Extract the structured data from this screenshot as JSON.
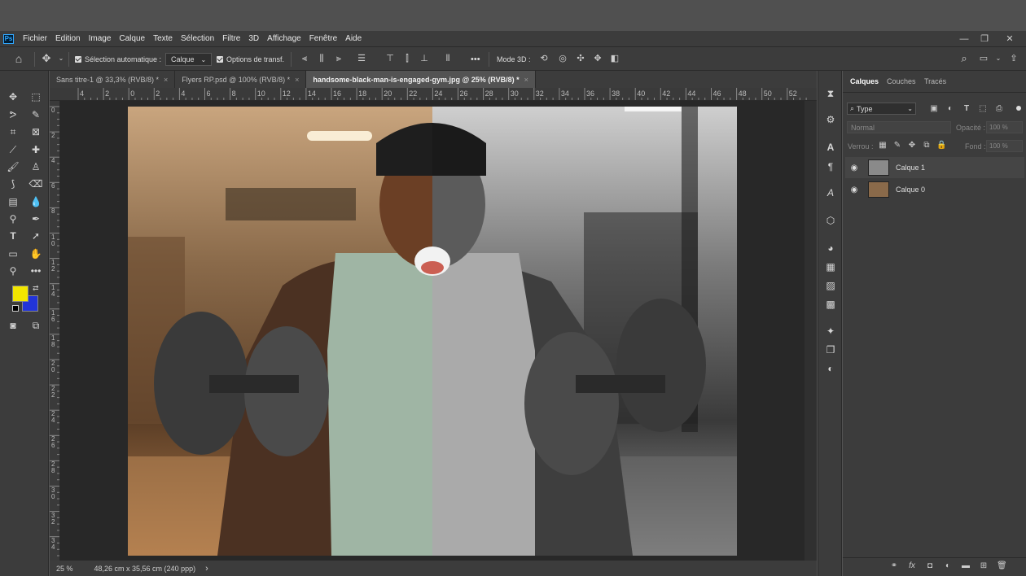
{
  "app": {
    "logo": "Ps"
  },
  "menu": [
    "Fichier",
    "Edition",
    "Image",
    "Calque",
    "Texte",
    "Sélection",
    "Filtre",
    "3D",
    "Affichage",
    "Fenêtre",
    "Aide"
  ],
  "window_controls": {
    "minimize": "—",
    "restore": "❐",
    "close": "✕"
  },
  "options": {
    "auto_select_label": "Sélection automatique :",
    "auto_select_value": "Calque",
    "transform_label": "Options de transf.",
    "more": "•••",
    "mode3d_label": "Mode 3D :"
  },
  "tabs": [
    {
      "label": "Sans titre-1 @ 33,3% (RVB/8) *",
      "close": "×"
    },
    {
      "label": "Flyers RP.psd @ 100% (RVB/8) *",
      "close": "×"
    },
    {
      "label": "handsome-black-man-is-engaged-gym.jpg @ 25% (RVB/8) *",
      "close": "×"
    }
  ],
  "ruler_h": [
    "4",
    "2",
    "0",
    "2",
    "4",
    "6",
    "8",
    "10",
    "12",
    "14",
    "16",
    "18",
    "20",
    "22",
    "24",
    "26",
    "28",
    "30",
    "32",
    "34",
    "36",
    "38",
    "40",
    "42",
    "44",
    "46",
    "48",
    "50",
    "52"
  ],
  "ruler_v": [
    "0",
    "2",
    "4",
    "6",
    "8",
    "1\n0",
    "1\n2",
    "1\n4",
    "1\n6",
    "1\n8",
    "2\n0",
    "2\n2",
    "2\n4",
    "2\n6",
    "2\n8",
    "3\n0",
    "3\n2",
    "3\n4"
  ],
  "status": {
    "zoom": "25 %",
    "doc_size": "48,26 cm x 35,56 cm (240 ppp)",
    "arrow": "›"
  },
  "colors": {
    "foreground": "#f2e600",
    "background": "#2234d8",
    "ps_blue": "#31a8ff"
  },
  "panel": {
    "tabs": [
      "Calques",
      "Couches",
      "Tracés"
    ],
    "filter_label": "Type",
    "blend_mode": "Normal",
    "opacity_label": "Opacité :",
    "opacity_value": "100 %",
    "lock_label": "Verrou :",
    "fill_label": "Fond :",
    "fill_value": "100 %",
    "layers": [
      {
        "name": "Calque 1",
        "visible_icon": "👁"
      },
      {
        "name": "Calque 0",
        "visible_icon": "👁"
      }
    ],
    "footer_icons": [
      "link-icon",
      "fx-icon",
      "mask-icon",
      "adjustment-icon",
      "folder-icon",
      "new-layer-icon",
      "trash-icon"
    ],
    "footer_fx": "fx"
  }
}
